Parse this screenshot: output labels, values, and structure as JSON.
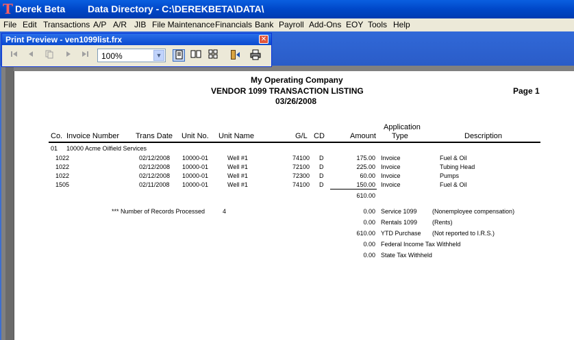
{
  "app": {
    "name": "Derek Beta",
    "directory": "Data Directory - C:\\DEREKBETA\\DATA\\"
  },
  "menu": [
    "File",
    "Edit",
    "Transactions",
    "A/P",
    "A/R",
    "JIB",
    "File Maintenance",
    "Financials",
    "Bank",
    "Payroll",
    "Add-Ons",
    "EOY",
    "Tools",
    "Help"
  ],
  "preview": {
    "title": "Print Preview - ven1099list.frx",
    "zoom": "100%",
    "close_label": "✕",
    "icons": [
      "first-page-icon",
      "prev-page-icon",
      "go-to-page-icon",
      "next-page-icon",
      "last-page-icon",
      "one-page-icon",
      "two-page-icon",
      "multi-page-icon",
      "close-preview-icon",
      "print-icon"
    ]
  },
  "report": {
    "company": "My Operating Company",
    "title": "VENDOR 1099 TRANSACTION LISTING",
    "date": "03/26/2008",
    "page": "Page 1",
    "headers": {
      "co": "Co.",
      "invoice": "Invoice Number",
      "trans_date": "Trans Date",
      "unit_no": "Unit No.",
      "unit_name": "Unit Name",
      "gl": "G/L",
      "cd": "CD",
      "amount": "Amount",
      "app_type_1": "Application",
      "app_type_2": "Type",
      "description": "Description"
    },
    "vendor_line": {
      "co": "01",
      "vendor": "10000  Acme Oilfield Services"
    },
    "rows": [
      {
        "invoice": "1022",
        "date": "02/12/2008",
        "unit_no": "10000-01",
        "unit_name": "Well #1",
        "gl": "74100",
        "cd": "D",
        "amount": "175.00",
        "type": "Invoice",
        "desc": "Fuel & Oil"
      },
      {
        "invoice": "1022",
        "date": "02/12/2008",
        "unit_no": "10000-01",
        "unit_name": "Well #1",
        "gl": "72100",
        "cd": "D",
        "amount": "225.00",
        "type": "Invoice",
        "desc": "Tubing Head"
      },
      {
        "invoice": "1022",
        "date": "02/12/2008",
        "unit_no": "10000-01",
        "unit_name": "Well #1",
        "gl": "72300",
        "cd": "D",
        "amount": "60.00",
        "type": "Invoice",
        "desc": "Pumps"
      },
      {
        "invoice": "1505",
        "date": "02/11/2008",
        "unit_no": "10000-01",
        "unit_name": "Well #1",
        "gl": "74100",
        "cd": "D",
        "amount": "150.00",
        "type": "Invoice",
        "desc": "Fuel & Oil"
      }
    ],
    "total": "610.00",
    "records_label": "*** Number of Records Processed",
    "records_count": "4",
    "summary": [
      {
        "amount": "0.00",
        "label": "Service 1099",
        "note": "(Nonemployee compensation)"
      },
      {
        "amount": "0.00",
        "label": "Rentals 1099",
        "note": "(Rents)"
      },
      {
        "amount": "610.00",
        "label": "YTD Purchase",
        "note": "(Not reported to I.R.S.)"
      },
      {
        "amount": "0.00",
        "label": "Federal Income Tax Withheld",
        "note": ""
      },
      {
        "amount": "0.00",
        "label": "State Tax Withheld",
        "note": ""
      }
    ]
  }
}
